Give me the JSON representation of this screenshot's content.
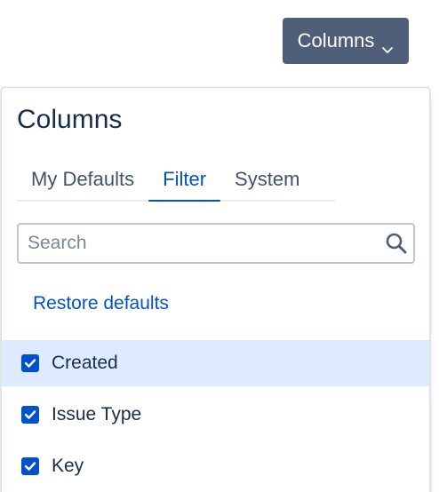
{
  "columns_button": {
    "label": "Columns",
    "icon": "chevron-down-icon"
  },
  "panel": {
    "title": "Columns",
    "tabs": [
      {
        "label": "My Defaults",
        "active": false
      },
      {
        "label": "Filter",
        "active": true
      },
      {
        "label": "System",
        "active": false
      }
    ],
    "search": {
      "placeholder": "Search",
      "value": "",
      "icon": "search-icon"
    },
    "restore_label": "Restore defaults",
    "items": [
      {
        "label": "Created",
        "checked": true,
        "highlighted": true
      },
      {
        "label": "Issue Type",
        "checked": true,
        "highlighted": false
      },
      {
        "label": "Key",
        "checked": true,
        "highlighted": false
      }
    ]
  },
  "colors": {
    "button_bg": "#505f79",
    "accent": "#0052cc",
    "text": "#172b4d",
    "highlight": "#deebff"
  }
}
